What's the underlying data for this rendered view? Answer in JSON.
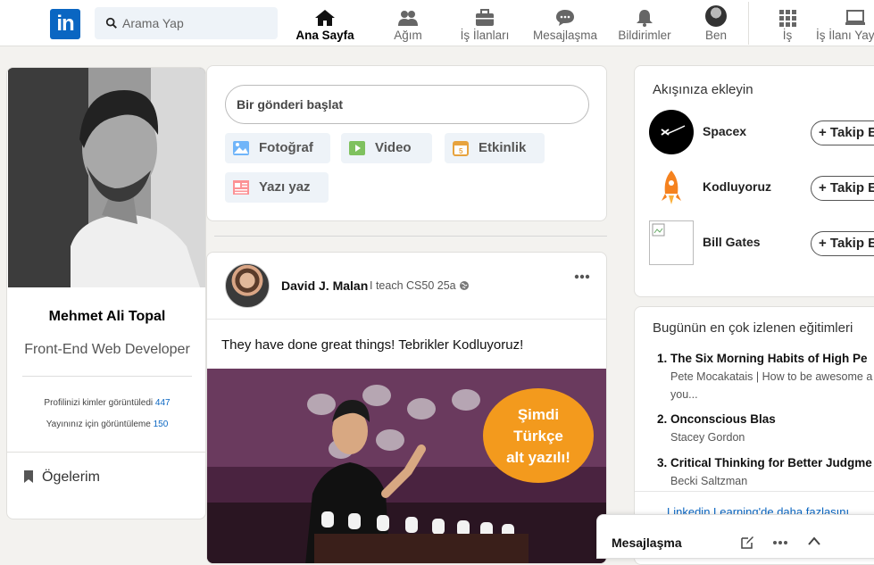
{
  "nav": {
    "search_placeholder": "Arama Yap",
    "items": [
      {
        "label": "Ana Sayfa",
        "icon": "home-icon"
      },
      {
        "label": "Ağım",
        "icon": "network-icon"
      },
      {
        "label": "İş İlanları",
        "icon": "briefcase-icon"
      },
      {
        "label": "Mesajlaşma",
        "icon": "messaging-icon"
      },
      {
        "label": "Bildirimler",
        "icon": "bell-icon"
      },
      {
        "label": "Ben",
        "icon": "avatar"
      },
      {
        "label": "İş",
        "icon": "grid-icon"
      },
      {
        "label": "İş İlanı Yay",
        "icon": "post-job-icon"
      }
    ],
    "logo_text": "in"
  },
  "profile": {
    "name": "Mehmet Ali Topal",
    "title": "Front-End Web Developer",
    "stats": [
      {
        "label": "Profilinizi kimler görüntüledi",
        "value": "447"
      },
      {
        "label": "Yayınınız için görüntüleme",
        "value": "150"
      }
    ],
    "items_label": "Ögelerim"
  },
  "share": {
    "placeholder": "Bir gönderi başlat",
    "actions": [
      {
        "label": "Fotoğraf",
        "icon": "photo-icon"
      },
      {
        "label": "Video",
        "icon": "video-icon"
      },
      {
        "label": "Etkinlik",
        "icon": "calendar-icon"
      },
      {
        "label": "Yazı yaz",
        "icon": "article-icon"
      }
    ]
  },
  "post": {
    "author": "David J. Malan",
    "meta": "I teach CS50 25a",
    "text": "They have done great things! Tebrikler Kodluyoruz!",
    "image_badge": [
      "Şimdi",
      "Türkçe",
      "alt yazılı!"
    ]
  },
  "follow": {
    "title": "Akışınıza ekleyin",
    "items": [
      {
        "name": "Spacex",
        "button": "+ Takip E"
      },
      {
        "name": "Kodluyoruz",
        "button": "+ Takip E"
      },
      {
        "name": "Bill Gates",
        "button": "+ Takip E"
      }
    ]
  },
  "courses": {
    "title": "Bugünün en çok izlenen eğitimleri",
    "items": [
      {
        "title": "1. The Six Morning Habits of High Pe",
        "sub": "Pete Mocakatais | How to be awesome a",
        "sub2": "you..."
      },
      {
        "title": "2. Onconscious Blas",
        "sub": "Stacey Gordon"
      },
      {
        "title": "3. Critical Thinking for Better Judgme",
        "sub": "Becki Saltzman"
      }
    ],
    "more": "Linkedin Learning'de daha fazlasını"
  },
  "messaging": {
    "title": "Mesajlaşma"
  },
  "colors": {
    "brand": "#0a66c2",
    "badge": "#f39a1d"
  }
}
